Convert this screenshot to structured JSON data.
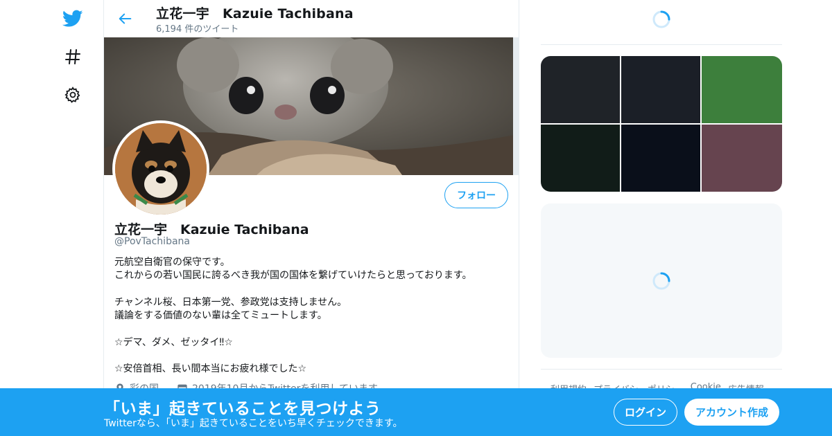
{
  "nav": {
    "items": [
      {
        "icon": "twitter-bird-icon",
        "color": "#1da1f2"
      },
      {
        "icon": "hashtag-icon"
      },
      {
        "icon": "gear-icon"
      }
    ]
  },
  "header": {
    "name": "立花一宇　Kazuie Tachibana",
    "tweet_count": "6,194 件のツイート",
    "back_icon": "arrow-left-icon"
  },
  "profile": {
    "display_name": "立花一宇　Kazuie Tachibana",
    "handle": "@PovTachibana",
    "follow_label": "フォロー",
    "bio": "元航空自衛官の保守です。\nこれからの若い国民に誇るべき我が国の国体を繋げていけたらと思っております。\n\nチャンネル桜、日本第一党、参政党は支持しません。\n議論をする価値のない輩は全てミュートします。\n\n☆デマ、ダメ、ゼッタイ‼☆\n\n☆安倍首相、長い間本当にお疲れ様でした☆",
    "location": "彩の国",
    "joined": "2019年10月からTwitterを利用しています"
  },
  "sidebar": {
    "media_colors": [
      "#1f2328",
      "#1b1f27",
      "#3d7f3c",
      "#111c18",
      "#0a0f1a",
      "#66444f"
    ],
    "footer_links": [
      "利用規約",
      "プライバシーポリシー",
      "Cookie",
      "広告情報"
    ]
  },
  "bottom_bar": {
    "headline": "「いま」起きていることを見つけよう",
    "subtext": "Twitterなら、「いま」起きていることをいち早くチェックできます。",
    "login_label": "ログイン",
    "signup_label": "アカウント作成"
  },
  "colors": {
    "accent": "#1da1f2",
    "muted_text": "#657786",
    "border": "#e6ecf0",
    "panel_bg": "#f5f8fa"
  }
}
